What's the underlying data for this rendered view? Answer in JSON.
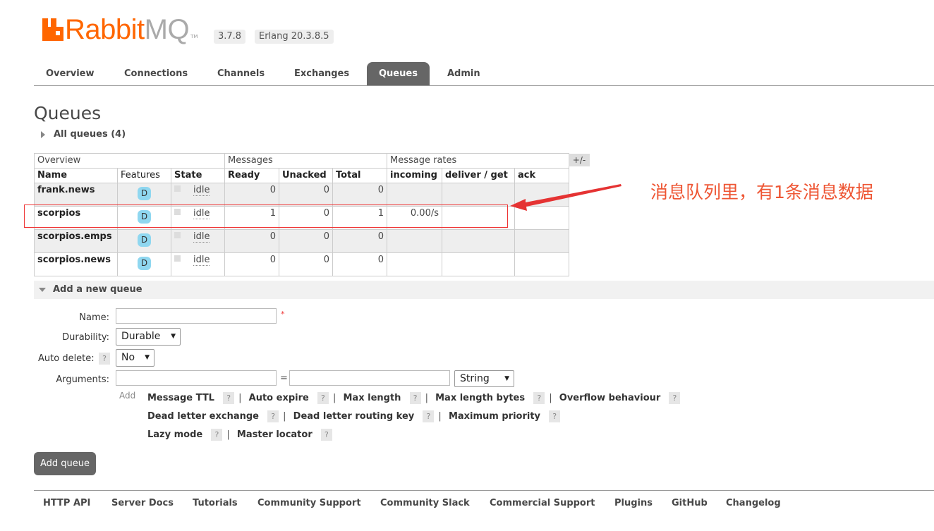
{
  "header": {
    "logo_text_rabbit": "Rabbit",
    "logo_text_mq": "MQ",
    "logo_tm": "TM",
    "version": "3.7.8",
    "erlang": "Erlang 20.3.8.5"
  },
  "tabs": [
    "Overview",
    "Connections",
    "Channels",
    "Exchanges",
    "Queues",
    "Admin"
  ],
  "active_tab": "Queues",
  "page_title": "Queues",
  "all_queues_label": "All queues (4)",
  "table": {
    "group_headers": [
      "Overview",
      "Messages",
      "Message rates"
    ],
    "plus_minus": "+/-",
    "columns": [
      "Name",
      "Features",
      "State",
      "Ready",
      "Unacked",
      "Total",
      "incoming",
      "deliver / get",
      "ack"
    ],
    "rows": [
      {
        "name": "frank.news",
        "feature": "D",
        "state": "idle",
        "ready": "0",
        "unacked": "0",
        "total": "0",
        "incoming": "",
        "deliver": "",
        "ack": ""
      },
      {
        "name": "scorpios",
        "feature": "D",
        "state": "idle",
        "ready": "1",
        "unacked": "0",
        "total": "1",
        "incoming": "0.00/s",
        "deliver": "",
        "ack": ""
      },
      {
        "name": "scorpios.emps",
        "feature": "D",
        "state": "idle",
        "ready": "0",
        "unacked": "0",
        "total": "0",
        "incoming": "",
        "deliver": "",
        "ack": ""
      },
      {
        "name": "scorpios.news",
        "feature": "D",
        "state": "idle",
        "ready": "0",
        "unacked": "0",
        "total": "0",
        "incoming": "",
        "deliver": "",
        "ack": ""
      }
    ]
  },
  "annotation": "消息队列里，有1条消息数据",
  "add_queue": {
    "section_title": "Add a new queue",
    "name_label": "Name:",
    "name_value": "",
    "required_mark": "*",
    "durability_label": "Durability:",
    "durability_value": "Durable",
    "auto_delete_label": "Auto delete:",
    "auto_delete_help": "?",
    "auto_delete_value": "No",
    "arguments_label": "Arguments:",
    "equals": "=",
    "arg_type_value": "String",
    "add_link": "Add",
    "arg_shortcuts": [
      [
        "Message TTL",
        "Auto expire",
        "Max length",
        "Max length bytes",
        "Overflow behaviour"
      ],
      [
        "Dead letter exchange",
        "Dead letter routing key",
        "Maximum priority"
      ],
      [
        "Lazy mode",
        "Master locator"
      ]
    ],
    "help_mark": "?",
    "separator": "|",
    "button": "Add queue"
  },
  "footer_links": [
    "HTTP API",
    "Server Docs",
    "Tutorials",
    "Community Support",
    "Community Slack",
    "Commercial Support",
    "Plugins",
    "GitHub",
    "Changelog"
  ],
  "colors": {
    "brand_orange": "#ff6600",
    "tab_active": "#666666",
    "feature_badge": "#8fd7f0",
    "annotation_red": "#e53333"
  }
}
